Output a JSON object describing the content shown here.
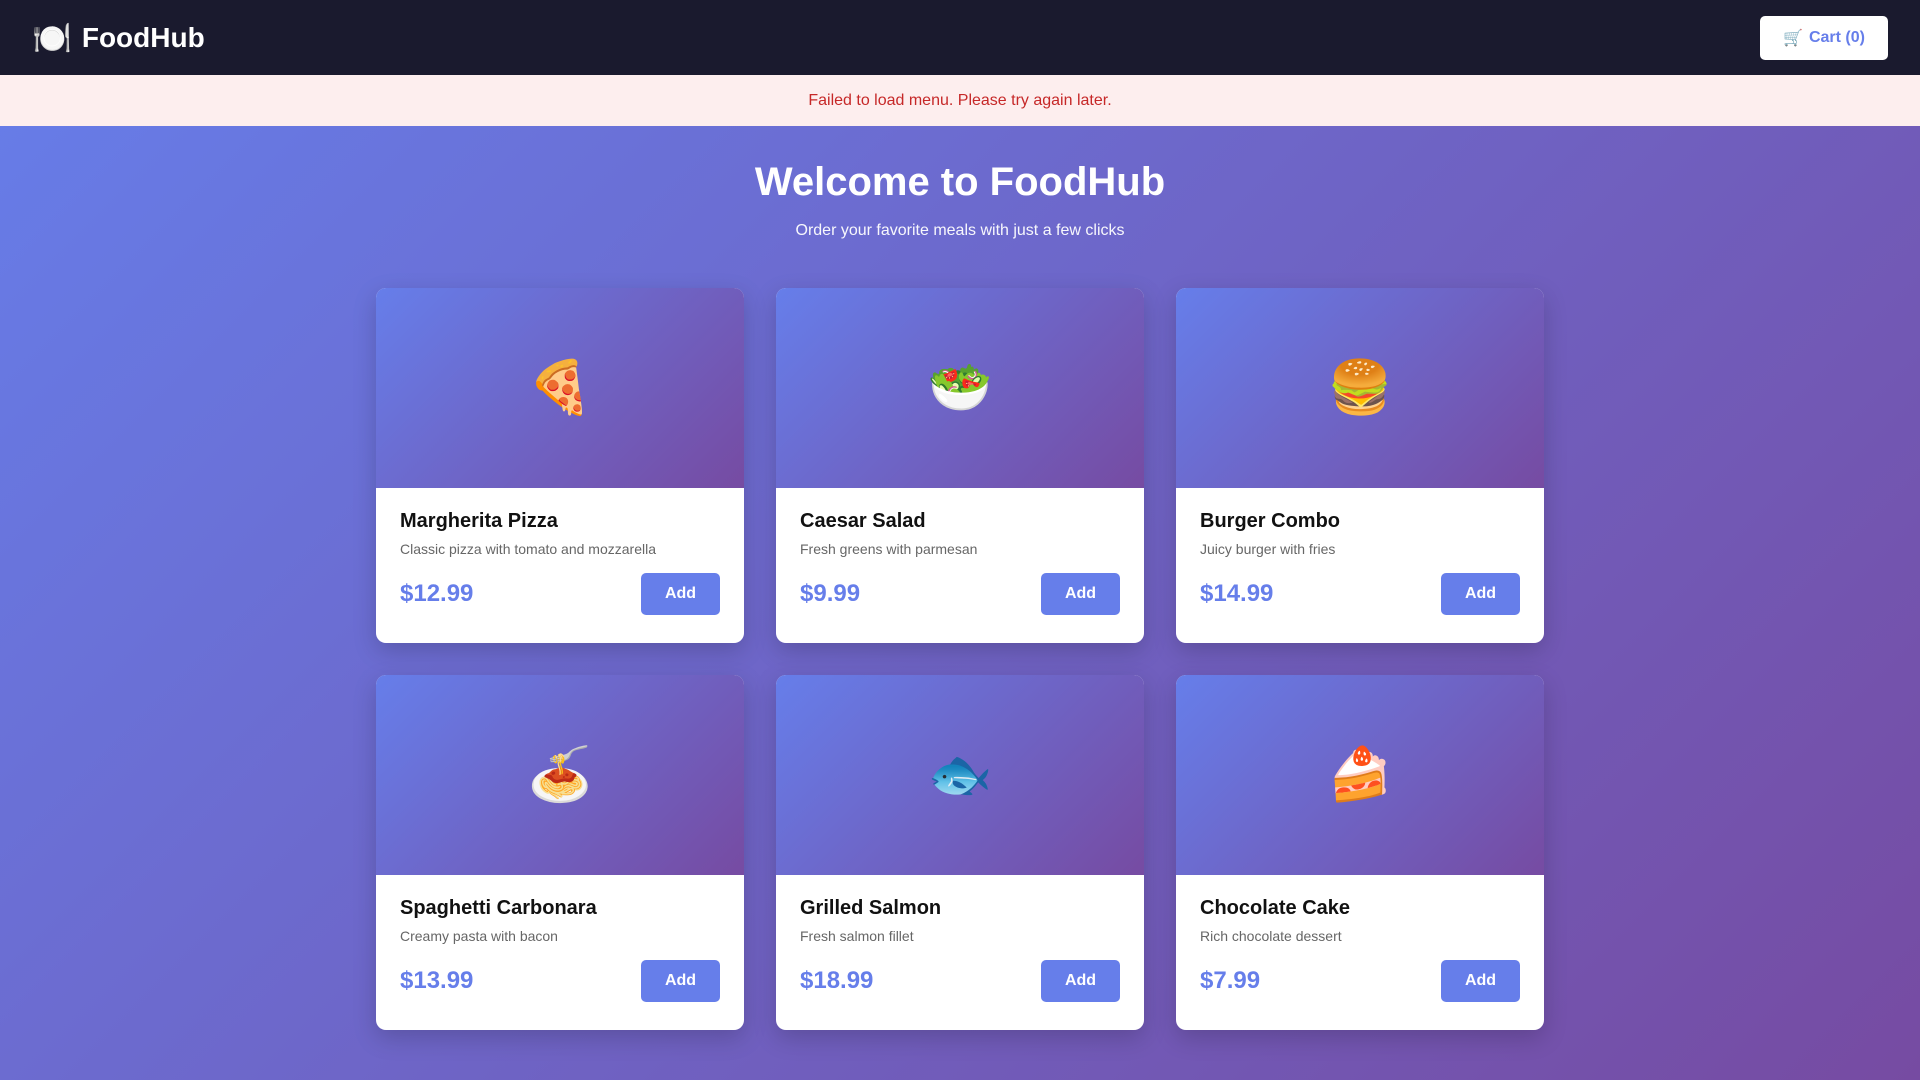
{
  "header": {
    "brand_icon": "🍽️",
    "brand_name": "FoodHub",
    "cart_icon": "🛒",
    "cart_label": "Cart (0)"
  },
  "alert": {
    "message": "Failed to load menu. Please try again later."
  },
  "hero": {
    "title": "Welcome to FoodHub",
    "subtitle": "Order your favorite meals with just a few clicks"
  },
  "menu": {
    "items": [
      {
        "emoji": "🍕",
        "name": "Margherita Pizza",
        "description": "Classic pizza with tomato and mozzarella",
        "price": "$12.99",
        "button_label": "Add"
      },
      {
        "emoji": "🥗",
        "name": "Caesar Salad",
        "description": "Fresh greens with parmesan",
        "price": "$9.99",
        "button_label": "Add"
      },
      {
        "emoji": "🍔",
        "name": "Burger Combo",
        "description": "Juicy burger with fries",
        "price": "$14.99",
        "button_label": "Add"
      },
      {
        "emoji": "🍝",
        "name": "Spaghetti Carbonara",
        "description": "Creamy pasta with bacon",
        "price": "$13.99",
        "button_label": "Add"
      },
      {
        "emoji": "🐟",
        "name": "Grilled Salmon",
        "description": "Fresh salmon fillet",
        "price": "$18.99",
        "button_label": "Add"
      },
      {
        "emoji": "🍰",
        "name": "Chocolate Cake",
        "description": "Rich chocolate dessert",
        "price": "$7.99",
        "button_label": "Add"
      }
    ]
  },
  "colors": {
    "header_bg": "#1a1a2e",
    "accent": "#667eea",
    "gradient_end": "#764ba2",
    "alert_bg": "#fdeeee",
    "alert_text": "#c62828"
  }
}
